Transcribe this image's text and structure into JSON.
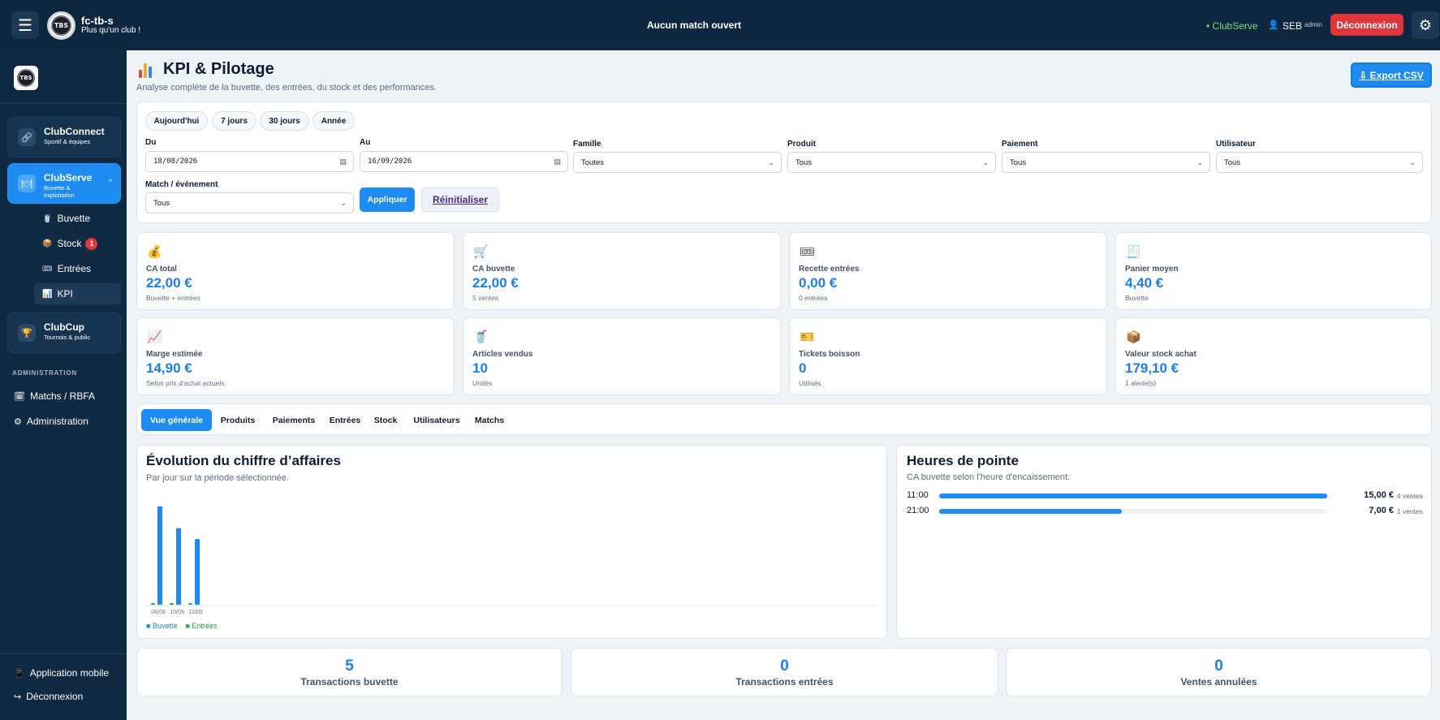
{
  "topbar": {
    "club_name": "fc-tb-s",
    "club_tagline": "Plus qu'un club !",
    "logo_text": "TBS",
    "match_status": "Aucun match ouvert",
    "context": "• ClubServe",
    "user": "SEB",
    "role": "admin",
    "logout": "Déconnexion"
  },
  "sidebar": {
    "groups": [
      {
        "title": "ClubConnect",
        "subtitle": "Sportif & équipes",
        "icon": "link-icon"
      },
      {
        "title": "ClubServe",
        "subtitle": "Buvette & exploitation",
        "icon": "serve-icon"
      },
      {
        "title": "ClubCup",
        "subtitle": "Tournois & public",
        "icon": "trophy-icon"
      }
    ],
    "serve_items": [
      {
        "label": "Buvette",
        "icon": "drink-icon"
      },
      {
        "label": "Stock",
        "icon": "box-icon",
        "badge": "1"
      },
      {
        "label": "Entrées",
        "icon": "ticket-icon"
      },
      {
        "label": "KPI",
        "icon": "chart-icon"
      }
    ],
    "admin_label": "ADMINISTRATION",
    "admin_items": [
      {
        "label": "Matchs / RBFA",
        "icon": "calendar-icon"
      },
      {
        "label": "Administration",
        "icon": "gear-icon"
      }
    ],
    "bottom_items": [
      {
        "label": "Application mobile",
        "icon": "phone-icon"
      },
      {
        "label": "Déconnexion",
        "icon": "logout-icon"
      }
    ]
  },
  "header": {
    "title": "KPI & Pilotage",
    "subtitle": "Analyse complète de la buvette, des entrées, du stock et des performances.",
    "export": "⇩ Export CSV"
  },
  "filters": {
    "presets": [
      "Aujourd'hui",
      "7 jours",
      "30 jours",
      "Année"
    ],
    "du_label": "Du",
    "du_value": "18/08/2026",
    "au_label": "Au",
    "au_value": "16/09/2026",
    "famille_label": "Famille",
    "famille_value": "Toutes",
    "produit_label": "Produit",
    "produit_value": "Tous",
    "paiement_label": "Paiement",
    "paiement_value": "Tous",
    "utilisateur_label": "Utilisateur",
    "utilisateur_value": "Tous",
    "match_label": "Match / événement",
    "match_value": "Tous",
    "apply": "Appliquer",
    "reset": "Réinitialiser"
  },
  "kpis": [
    {
      "icon": "💰",
      "icon_name": "money-bag-icon",
      "label": "CA total",
      "value": "22,00 €",
      "sub": "Buvette + entrées"
    },
    {
      "icon": "🛒",
      "icon_name": "cart-icon",
      "label": "CA buvette",
      "value": "22,00 €",
      "sub": "5 ventes"
    },
    {
      "icon": "🎟",
      "icon_name": "ticket-icon",
      "label": "Recette entrées",
      "value": "0,00 €",
      "sub": "0 entrées"
    },
    {
      "icon": "🧾",
      "icon_name": "receipt-icon",
      "label": "Panier moyen",
      "value": "4,40 €",
      "sub": "Buvette"
    },
    {
      "icon": "📈",
      "icon_name": "trend-icon",
      "label": "Marge estimée",
      "value": "14,90 €",
      "sub": "Selon prix d'achat actuels"
    },
    {
      "icon": "🥤",
      "icon_name": "cup-icon",
      "label": "Articles vendus",
      "value": "10",
      "sub": "Unités"
    },
    {
      "icon": "🎫",
      "icon_name": "voucher-icon",
      "label": "Tickets boisson",
      "value": "0",
      "sub": "Utilisés"
    },
    {
      "icon": "📦",
      "icon_name": "box-icon",
      "label": "Valeur stock achat",
      "value": "179,10 €",
      "sub": "1 alerte(s)"
    }
  ],
  "tabs": [
    "Vue générale",
    "Produits",
    "Paiements",
    "Entrées",
    "Stock",
    "Utilisateurs",
    "Matchs"
  ],
  "revenue_card": {
    "title": "Évolution du chiffre d’affaires",
    "subtitle": "Par jour sur la période sélectionnée."
  },
  "chart_data": {
    "type": "bar",
    "categories": [
      "08/09",
      "10/09",
      "12/09"
    ],
    "series": [
      {
        "name": "Buvette",
        "values": [
          9,
          7,
          6
        ],
        "color": "#1d8bf0"
      },
      {
        "name": "Entrées",
        "values": [
          0,
          0,
          0
        ],
        "color": "#22b04b"
      }
    ],
    "ylim": [
      0,
      9.5
    ],
    "legend": "bottom-left"
  },
  "peak_card": {
    "title": "Heures de pointe",
    "subtitle": "CA buvette selon l'heure d'encaissement.",
    "rows": [
      {
        "hour": "11:00",
        "value": "15,00 €",
        "count": "4 ventes",
        "fraction": 1.0
      },
      {
        "hour": "21:00",
        "value": "7,00 €",
        "count": "1 ventes",
        "fraction": 0.47
      }
    ]
  },
  "stats": [
    {
      "value": "5",
      "label": "Transactions buvette"
    },
    {
      "value": "0",
      "label": "Transactions entrées"
    },
    {
      "value": "0",
      "label": "Ventes annulées"
    }
  ]
}
